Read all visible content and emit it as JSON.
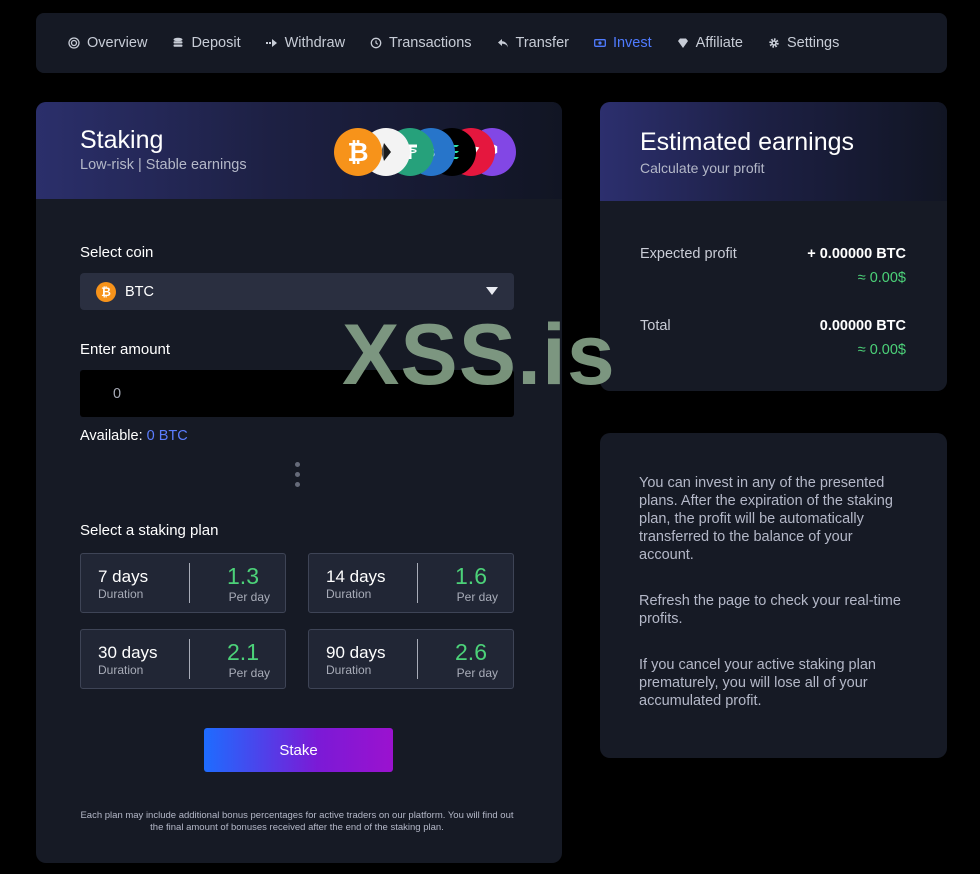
{
  "nav": [
    {
      "label": "Overview",
      "icon": "target-icon"
    },
    {
      "label": "Deposit",
      "icon": "coins-stack-icon"
    },
    {
      "label": "Withdraw",
      "icon": "arrow-out-icon"
    },
    {
      "label": "Transactions",
      "icon": "history-icon"
    },
    {
      "label": "Transfer",
      "icon": "reply-arrow-icon"
    },
    {
      "label": "Invest",
      "icon": "banknote-icon",
      "active": true
    },
    {
      "label": "Affiliate",
      "icon": "gem-icon"
    },
    {
      "label": "Settings",
      "icon": "gear-icon"
    }
  ],
  "staking": {
    "title": "Staking",
    "subtitle": "Low-risk | Stable earnings",
    "coins": [
      {
        "symbol": "₿",
        "icon": "bitcoin-icon",
        "color": "#f7931a"
      },
      {
        "symbol": "◆",
        "icon": "ethereum-icon",
        "color": "#ffffff"
      },
      {
        "symbol": "₮",
        "icon": "tether-icon",
        "color": "#26a17b"
      },
      {
        "symbol": "$",
        "icon": "usdc-icon",
        "color": "#2775ca"
      },
      {
        "symbol": "≡",
        "icon": "solana-icon",
        "color": "#000000"
      },
      {
        "symbol": "▲",
        "icon": "tron-icon",
        "color": "#e5173e"
      },
      {
        "symbol": "◯",
        "icon": "polygon-icon",
        "color": "#8247e5"
      }
    ],
    "select_coin_label": "Select coin",
    "selected_coin": "BTC",
    "enter_amount_label": "Enter amount",
    "amount_placeholder": "0",
    "available_label": "Available:",
    "available_value": "0 BTC",
    "select_plan_label": "Select a staking plan",
    "plans": [
      {
        "days": "7 days",
        "duration_label": "Duration",
        "rate": "1.3",
        "per_label": "Per day"
      },
      {
        "days": "14 days",
        "duration_label": "Duration",
        "rate": "1.6",
        "per_label": "Per day"
      },
      {
        "days": "30 days",
        "duration_label": "Duration",
        "rate": "2.1",
        "per_label": "Per day"
      },
      {
        "days": "90 days",
        "duration_label": "Duration",
        "rate": "2.6",
        "per_label": "Per day"
      }
    ],
    "stake_button": "Stake",
    "footnote": "Each plan may include additional bonus percentages for active traders on our platform. You will find out the final amount of bonuses received after the end of the staking plan."
  },
  "earnings": {
    "title": "Estimated earnings",
    "subtitle": "Calculate your profit",
    "expected_label": "Expected profit",
    "expected_value": "+ 0.00000 BTC",
    "expected_usd": "≈ 0.00$",
    "total_label": "Total",
    "total_value": "0.00000 BTC",
    "total_usd": "≈ 0.00$"
  },
  "info": {
    "p1": "You can invest in any of the presented plans. After the expiration of the staking plan, the profit will be automatically transferred to the balance of your account.",
    "p2": "Refresh the page to check your real-time profits.",
    "p3": "If you cancel your active staking plan prematurely, you will lose all of your accumulated profit."
  },
  "watermark": "XSS.is",
  "colors": {
    "accent": "#4f7bff",
    "positive": "#4cd279",
    "bitcoin": "#f7931a"
  }
}
